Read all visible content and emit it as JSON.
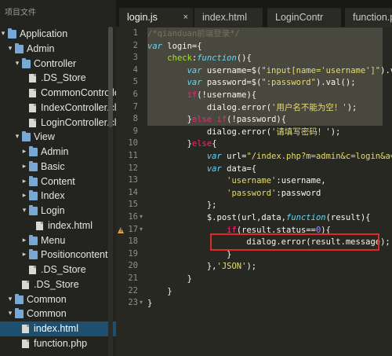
{
  "sidebar": {
    "header": "项目文件",
    "items": [
      {
        "label": "Application",
        "depth": 0,
        "type": "folder",
        "open": true
      },
      {
        "label": "Admin",
        "depth": 1,
        "type": "folder",
        "open": true
      },
      {
        "label": "Controller",
        "depth": 2,
        "type": "folder",
        "open": true
      },
      {
        "label": ".DS_Store",
        "depth": 3,
        "type": "file"
      },
      {
        "label": "CommonController.c",
        "depth": 3,
        "type": "file"
      },
      {
        "label": "IndexController.clas",
        "depth": 3,
        "type": "file"
      },
      {
        "label": "LoginController.clas",
        "depth": 3,
        "type": "file"
      },
      {
        "label": "View",
        "depth": 2,
        "type": "folder",
        "open": true
      },
      {
        "label": "Admin",
        "depth": 3,
        "type": "folder",
        "open": false
      },
      {
        "label": "Basic",
        "depth": 3,
        "type": "folder",
        "open": false
      },
      {
        "label": "Content",
        "depth": 3,
        "type": "folder",
        "open": false
      },
      {
        "label": "Index",
        "depth": 3,
        "type": "folder",
        "open": false
      },
      {
        "label": "Login",
        "depth": 3,
        "type": "folder",
        "open": true
      },
      {
        "label": "index.html",
        "depth": 4,
        "type": "file"
      },
      {
        "label": "Menu",
        "depth": 3,
        "type": "folder",
        "open": false
      },
      {
        "label": "Positioncontent",
        "depth": 3,
        "type": "folder",
        "open": false
      },
      {
        "label": ".DS_Store",
        "depth": 3,
        "type": "file"
      },
      {
        "label": ".DS_Store",
        "depth": 2,
        "type": "file"
      },
      {
        "label": "Common",
        "depth": 1,
        "type": "folder",
        "open": true
      },
      {
        "label": "Common",
        "depth": 1,
        "type": "folder",
        "open": true
      },
      {
        "label": "index.html",
        "depth": 2,
        "type": "file",
        "selected": true
      },
      {
        "label": "function.php",
        "depth": 2,
        "type": "file"
      }
    ]
  },
  "tabs": [
    {
      "label": "login.js",
      "active": true,
      "close": "×"
    },
    {
      "label": "index.html",
      "active": false
    },
    {
      "label": "LoginContr",
      "active": false
    },
    {
      "label": "function.ph",
      "active": false
    }
  ],
  "editor": {
    "selected_lines": [
      1,
      2,
      3,
      4,
      5,
      6,
      7,
      8
    ],
    "warning_line": 17,
    "fold_lines": [
      16,
      17,
      23
    ],
    "highlight_box_line": 18,
    "lines": [
      {
        "n": "1",
        "tokens": [
          [
            "c",
            "/*qianduan前端登录*/"
          ]
        ]
      },
      {
        "n": "2",
        "tokens": [
          [
            "k",
            "var"
          ],
          [
            "p",
            " login={"
          ]
        ]
      },
      {
        "n": "3",
        "tokens": [
          [
            "p",
            "    "
          ],
          [
            "f",
            "check"
          ],
          [
            "p",
            ":"
          ],
          [
            "k",
            "function"
          ],
          [
            "p",
            "(){"
          ]
        ]
      },
      {
        "n": "4",
        "tokens": [
          [
            "p",
            "        "
          ],
          [
            "k",
            "var"
          ],
          [
            "p",
            " username=$("
          ],
          [
            "s",
            "\"input[name='username']\""
          ],
          [
            "p",
            ").val"
          ]
        ]
      },
      {
        "n": "5",
        "tokens": [
          [
            "p",
            "        "
          ],
          [
            "k",
            "var"
          ],
          [
            "p",
            " password=$("
          ],
          [
            "s",
            "\":password\""
          ],
          [
            "p",
            ").val();"
          ]
        ]
      },
      {
        "n": "6",
        "tokens": [
          [
            "p",
            "        "
          ],
          [
            "kw",
            "if"
          ],
          [
            "p",
            "(!username){"
          ]
        ]
      },
      {
        "n": "7",
        "tokens": [
          [
            "p",
            "            dialog.error("
          ],
          [
            "s",
            "'用户名不能为空！'"
          ],
          [
            "p",
            ");"
          ]
        ]
      },
      {
        "n": "8",
        "tokens": [
          [
            "p",
            "        }"
          ],
          [
            "kw",
            "else if"
          ],
          [
            "p",
            "(!password){"
          ]
        ]
      },
      {
        "n": "9",
        "tokens": [
          [
            "p",
            "            dialog.error("
          ],
          [
            "s",
            "'请填写密码！'"
          ],
          [
            "p",
            ");"
          ]
        ]
      },
      {
        "n": "10",
        "tokens": [
          [
            "p",
            "        }"
          ],
          [
            "kw",
            "else"
          ],
          [
            "p",
            "{"
          ]
        ]
      },
      {
        "n": "11",
        "tokens": [
          [
            "p",
            "            "
          ],
          [
            "k",
            "var"
          ],
          [
            "p",
            " url="
          ],
          [
            "s",
            "\"/index.php?m=admin&c=login&a=ch"
          ]
        ]
      },
      {
        "n": "12",
        "tokens": [
          [
            "p",
            "            "
          ],
          [
            "k",
            "var"
          ],
          [
            "p",
            " data={"
          ]
        ]
      },
      {
        "n": "13",
        "tokens": [
          [
            "p",
            "                "
          ],
          [
            "s",
            "'username'"
          ],
          [
            "p",
            ":username,"
          ]
        ]
      },
      {
        "n": "14",
        "tokens": [
          [
            "p",
            "                "
          ],
          [
            "s",
            "'password'"
          ],
          [
            "p",
            ":password"
          ]
        ]
      },
      {
        "n": "15",
        "tokens": [
          [
            "p",
            "            };"
          ]
        ]
      },
      {
        "n": "16",
        "tokens": [
          [
            "p",
            "            $.post(url,data,"
          ],
          [
            "k",
            "function"
          ],
          [
            "p",
            "(result){"
          ]
        ]
      },
      {
        "n": "17",
        "tokens": [
          [
            "p",
            "                "
          ],
          [
            "kw",
            "if"
          ],
          [
            "p",
            "(result.status=="
          ],
          [
            "n",
            "0"
          ],
          [
            "p",
            "){"
          ]
        ]
      },
      {
        "n": "18",
        "tokens": [
          [
            "p",
            "                    dialog.error(result.message);"
          ]
        ]
      },
      {
        "n": "19",
        "tokens": [
          [
            "p",
            "                }"
          ]
        ]
      },
      {
        "n": "20",
        "tokens": [
          [
            "p",
            "            },"
          ],
          [
            "s",
            "'JSON'"
          ],
          [
            "p",
            ");"
          ]
        ]
      },
      {
        "n": "21",
        "tokens": [
          [
            "p",
            "        }"
          ]
        ]
      },
      {
        "n": "22",
        "tokens": [
          [
            "p",
            "    }"
          ]
        ]
      },
      {
        "n": "23",
        "tokens": [
          [
            "p",
            "}"
          ]
        ]
      }
    ]
  },
  "icons": {
    "folder": "folder-icon",
    "file": "file-icon",
    "chevron_open": "chevron-down-icon",
    "chevron_closed": "chevron-right-icon",
    "warning": "warning-icon",
    "fold": "fold-arrow-icon"
  },
  "colors": {
    "error_box": "#e0292b",
    "selection": "#49483e",
    "selected_file": "#1e4f6e"
  }
}
